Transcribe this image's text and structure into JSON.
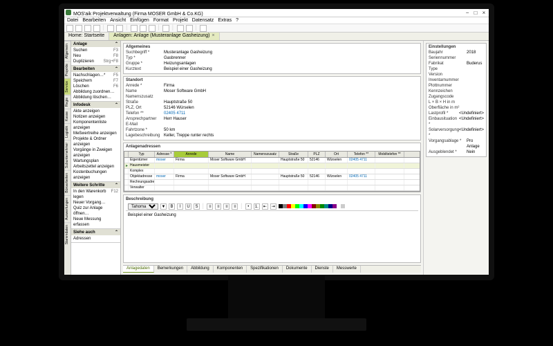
{
  "window": {
    "title": "MOS'aik Projektverwaltung (Firma MOSER GmbH & Co.KG)"
  },
  "menu": [
    "Datei",
    "Bearbeiten",
    "Ansicht",
    "Einfügen",
    "Format",
    "Projekt",
    "Datensatz",
    "Extras",
    "?"
  ],
  "toolbarIcons": [
    "new",
    "open",
    "save",
    "print",
    "|",
    "undo",
    "redo",
    "|",
    "cut",
    "copy",
    "paste",
    "|",
    "find",
    "|",
    "back",
    "fwd",
    "|",
    "help"
  ],
  "tabs": [
    {
      "label": "Home: Startseite",
      "active": false
    },
    {
      "label": "Anlagen: Anlage (Musteranlage Gasheizung)",
      "active": true
    }
  ],
  "vtabs": [
    "Allgemein",
    "Projekte",
    "Service",
    "Regie",
    "Kasse",
    "Logistik",
    "Subunternehmer",
    "Büroarbeiten",
    "Auswertungen",
    "Stammdaten"
  ],
  "vtabActive": "Service",
  "sidebar": {
    "panels": [
      {
        "title": "Anlage",
        "items": [
          {
            "label": "Suchen",
            "sc": "F3"
          },
          {
            "label": "Neu",
            "sc": "F8"
          },
          {
            "label": "Duplizieren",
            "sc": "Strg+F8"
          }
        ]
      },
      {
        "title": "Bearbeiten",
        "items": [
          {
            "label": "Nachschlagen…*",
            "sc": "F5"
          },
          {
            "label": "Speichern",
            "sc": "F7"
          },
          {
            "label": "Löschen",
            "sc": "F6"
          },
          {
            "label": "Abbildung zuordnen…",
            "sc": ""
          },
          {
            "label": "Abbildung löschen…",
            "sc": ""
          }
        ]
      },
      {
        "title": "Infodesk",
        "items": [
          {
            "label": "Akte anzeigen",
            "sc": ""
          },
          {
            "label": "Notizen anzeigen",
            "sc": ""
          },
          {
            "label": "Komponentenliste anzeigen",
            "sc": ""
          },
          {
            "label": "Meßwertreihe anzeigen",
            "sc": ""
          },
          {
            "label": "Projekte & Ordner anzeigen",
            "sc": ""
          },
          {
            "label": "Vorgänge in Zweigen anzeigen",
            "sc": ""
          },
          {
            "label": "Wartungsplan",
            "sc": ""
          },
          {
            "label": "Arbeitszettel anzeigen",
            "sc": ""
          },
          {
            "label": "Kostenbuchungen anzeigen",
            "sc": ""
          }
        ]
      },
      {
        "title": "Weitere Schritte",
        "items": [
          {
            "label": "In den Warenkorb legen",
            "sc": "F12"
          },
          {
            "label": "Neuer Vorgang…",
            "sc": ""
          },
          {
            "label": "Quiz zur Anlage öffnen…",
            "sc": ""
          },
          {
            "label": "Neue Messung erfassen",
            "sc": ""
          }
        ]
      },
      {
        "title": "Siehe auch",
        "items": [
          {
            "label": "Adressen",
            "sc": ""
          }
        ]
      }
    ]
  },
  "allgemeines": {
    "title": "Allgemeines",
    "fields": [
      {
        "lbl": "Suchbegriff *",
        "val": "Musteranlage Gasheizung"
      },
      {
        "lbl": "Typ *",
        "val": "Gasbrenner"
      },
      {
        "lbl": "Gruppe *",
        "val": "Heizungsanlagen"
      },
      {
        "lbl": "Kurztext",
        "val": "Beispiel einer Gasheizung"
      }
    ]
  },
  "standort": {
    "title": "Standort",
    "fields": [
      {
        "lbl": "Anrede *",
        "val": "Firma"
      },
      {
        "lbl": "Name",
        "val": "Moser Software GmbH"
      },
      {
        "lbl": "Namenszusatz",
        "val": ""
      },
      {
        "lbl": "Straße",
        "val": "Hauptstraße 50"
      },
      {
        "lbl": "PLZ, Ort",
        "val": "52146   Würselen"
      },
      {
        "lbl": "Telefon **",
        "val": "02405 4711",
        "link": true
      },
      {
        "lbl": "Ansprechpartner",
        "val": "Herr Hauser"
      },
      {
        "lbl": "E-Mail",
        "val": ""
      },
      {
        "lbl": "Fahrtzone *",
        "val": "50 km"
      },
      {
        "lbl": "Lagebeschreibung",
        "val": "Keller, Treppe runter rechts"
      }
    ]
  },
  "einstellungen": {
    "title": "Einstellungen",
    "fields": [
      {
        "lbl": "Baujahr",
        "val": "2018"
      },
      {
        "lbl": "Seriennummer",
        "val": ""
      },
      {
        "lbl": "Fabrikat",
        "val": "Buderus"
      },
      {
        "lbl": "Type",
        "val": ""
      },
      {
        "lbl": "Version",
        "val": ""
      },
      {
        "lbl": "Inventarnummer",
        "val": ""
      },
      {
        "lbl": "Plottnummer",
        "val": ""
      },
      {
        "lbl": "Kennzeichen",
        "val": ""
      },
      {
        "lbl": "Zugangscode",
        "val": ""
      },
      {
        "lbl": "L × B × H in m",
        "val": ""
      },
      {
        "lbl": "Oberfläche in m²",
        "val": ""
      },
      {
        "lbl": "Lastprofil *",
        "val": "<Undefiniert>"
      },
      {
        "lbl": "Einbausituation *",
        "val": "<Undefiniert>"
      },
      {
        "lbl": "Solarversorgung *",
        "val": "<Undefiniert>"
      },
      {
        "lbl": "Vorgangsablage *",
        "val": "Pro Anlage"
      },
      {
        "lbl": "Ausgeblendet *",
        "val": "Nein"
      }
    ]
  },
  "grid": {
    "title": "Anlagenadressen",
    "cols": [
      "Typ",
      "Adresse *",
      "Anrede",
      "Name",
      "Namenszusatz",
      "Straße",
      "PLZ",
      "Ort",
      "Telefon **",
      "Mobiltelefon **"
    ],
    "activeCol": 2,
    "rows": [
      {
        "cells": [
          "Eigentümer",
          "moser",
          "Firma",
          "Moser Software GmbH",
          "",
          "Hauptstraße 50",
          "52146",
          "Würselen",
          "02405 4711",
          ""
        ],
        "linkCols": [
          1,
          8
        ]
      },
      {
        "cells": [
          "Hausmeister",
          "",
          "",
          "",
          "",
          "",
          "",
          "",
          "",
          ""
        ],
        "current": true
      },
      {
        "cells": [
          "Komplex",
          "",
          "",
          "",
          "",
          "",
          "",
          "",
          "",
          ""
        ]
      },
      {
        "cells": [
          "Objektadresse",
          "moser",
          "Firma",
          "Moser Software GmbH",
          "",
          "Hauptstraße 50",
          "52146",
          "Würselen",
          "02405 4711",
          ""
        ],
        "linkCols": [
          1,
          8
        ]
      },
      {
        "cells": [
          "Rechnungsadresse",
          "",
          "",
          "",
          "",
          "",
          "",
          "",
          "",
          ""
        ]
      },
      {
        "cells": [
          "Verwalter",
          "",
          "",
          "",
          "",
          "",
          "",
          "",
          "",
          ""
        ]
      }
    ]
  },
  "editor": {
    "title": "Beschreibung",
    "font": "Tahoma",
    "content": "Beispiel einer Gasheizung",
    "colors": [
      "#000",
      "#7f7f7f",
      "#f00",
      "#ff0",
      "#0f0",
      "#0ff",
      "#00f",
      "#f0f",
      "#800",
      "#880",
      "#080",
      "#088",
      "#008",
      "#808",
      "#fff",
      "#ccc"
    ]
  },
  "bottomTabs": [
    "Anlagedaten",
    "Bemerkungen",
    "Abbildung",
    "Komponenten",
    "Spezifikationen",
    "Dokumente",
    "Dienste",
    "Messwerte"
  ],
  "bottomActive": 0
}
